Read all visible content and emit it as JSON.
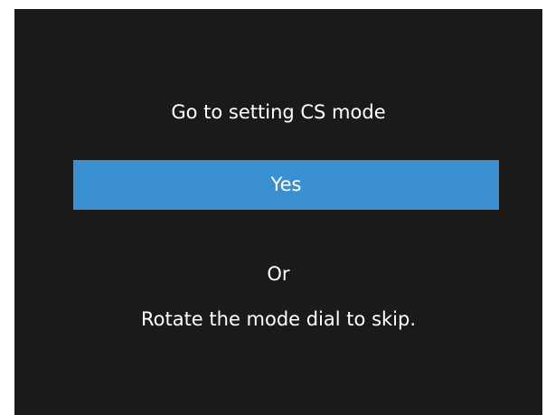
{
  "dialog": {
    "prompt": "Go to setting CS mode",
    "yes_label": "Yes",
    "or_label": "Or",
    "rotate_hint": "Rotate the mode dial to skip."
  },
  "colors": {
    "background": "#1c1a19",
    "highlight": "#3a8fd0",
    "text": "#ffffff"
  }
}
